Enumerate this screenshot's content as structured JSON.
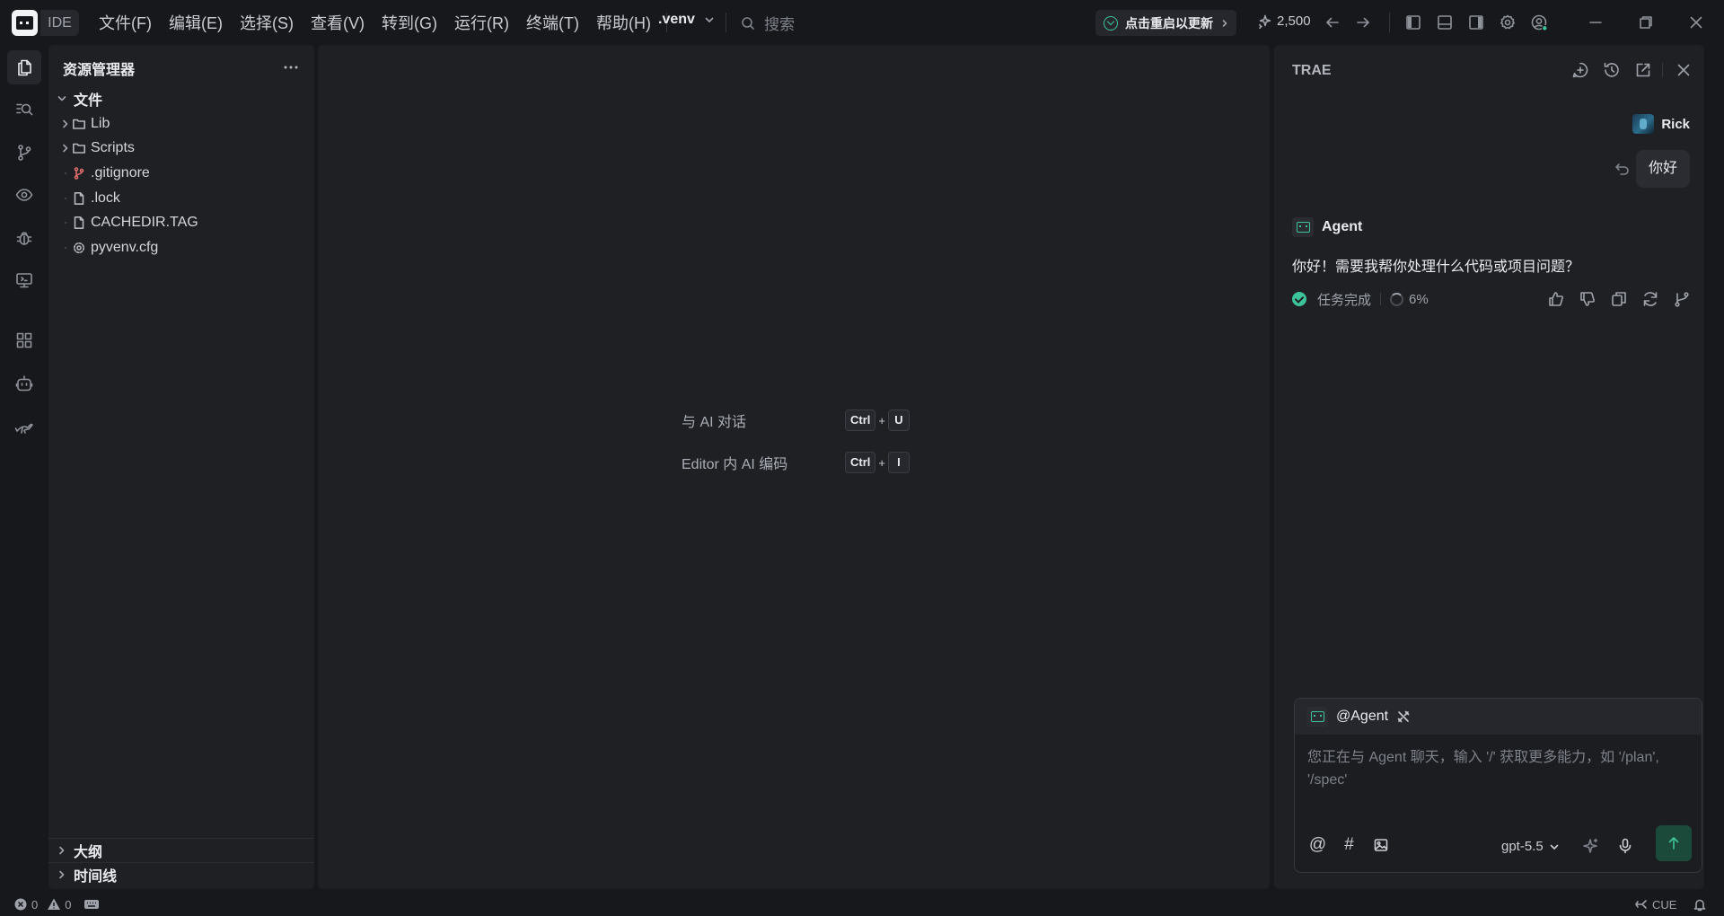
{
  "titlebar": {
    "app_badge": "IDE",
    "menus": [
      "文件(F)",
      "编辑(E)",
      "选择(S)",
      "查看(V)",
      "转到(G)",
      "运行(R)",
      "终端(T)",
      "帮助(H)"
    ],
    "workspace": ".venv",
    "search_placeholder": "搜索",
    "update_label": "点击重启以更新",
    "credits": "2,500"
  },
  "explorer": {
    "title": "资源管理器",
    "root": "文件",
    "items": [
      {
        "label": "Lib",
        "icon": "folder-icon"
      },
      {
        "label": "Scripts",
        "icon": "folder-icon"
      },
      {
        "label": ".gitignore",
        "icon": "git-icon"
      },
      {
        "label": ".lock",
        "icon": "file-icon"
      },
      {
        "label": "CACHEDIR.TAG",
        "icon": "file-icon"
      },
      {
        "label": "pyvenv.cfg",
        "icon": "gear-icon"
      }
    ],
    "outline": "大纲",
    "timeline": "时间线"
  },
  "editor": {
    "hints": [
      {
        "label": "与 AI 对话",
        "keys": [
          "Ctrl",
          "U"
        ]
      },
      {
        "label": "Editor 内 AI 编码",
        "keys": [
          "Ctrl",
          "I"
        ]
      }
    ],
    "plus": "+"
  },
  "chat": {
    "title": "TRAE",
    "user_name": "Rick",
    "user_message": "你好",
    "agent_name": "Agent",
    "agent_message": "你好！需要我帮你处理什么代码或项目问题？",
    "status": "任务完成",
    "progress": "6%",
    "input_mention": "@Agent",
    "input_placeholder": "您正在与 Agent 聊天，输入 '/' 获取更多能力，如 '/plan', '/spec'",
    "model": "gpt-5.5"
  },
  "statusbar": {
    "errors": "0",
    "warnings": "0",
    "cue": "CUE"
  },
  "colors": {
    "background": "#17181b",
    "panel": "#1f2024",
    "accent_green": "#3dc39a",
    "git_red": "#e06c6c"
  }
}
